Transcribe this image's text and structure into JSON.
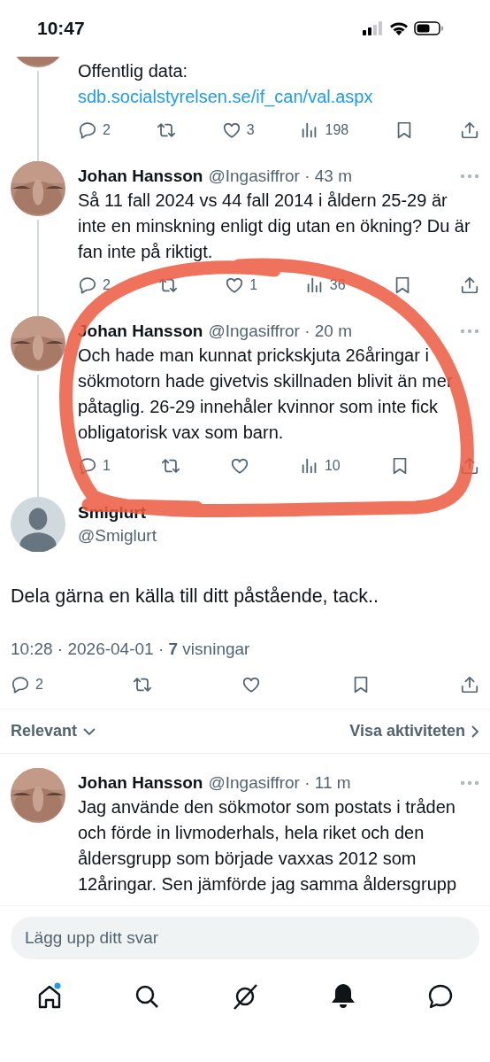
{
  "status_bar": {
    "time": "10:47"
  },
  "thread": [
    {
      "kind": "cut",
      "text": "Offentlig data: ",
      "link": "sdb.socialstyrelsen.se/if_can/val.aspx",
      "actions": [
        {
          "kind": "reply",
          "count": "2"
        },
        {
          "kind": "repost"
        },
        {
          "kind": "like",
          "count": "3"
        },
        {
          "kind": "views",
          "count": "198"
        },
        {
          "kind": "bookmark"
        },
        {
          "kind": "share"
        }
      ]
    },
    {
      "kind": "reply",
      "name": "Johan Hansson",
      "byline": "@Ingasiffror · 43 m",
      "text": "Så 11 fall 2024 vs 44 fall 2014 i åldern 25-29 är inte en minskning enligt dig utan en ökning? Du är fan inte på riktigt.",
      "actions": [
        {
          "kind": "reply",
          "count": "2"
        },
        {
          "kind": "repost"
        },
        {
          "kind": "like",
          "count": "1"
        },
        {
          "kind": "views",
          "count": "36"
        },
        {
          "kind": "bookmark"
        },
        {
          "kind": "share"
        }
      ]
    },
    {
      "kind": "reply",
      "name": "Johan Hansson",
      "byline": "@Ingasiffror · 20 m",
      "text": "Och hade man kunnat prickskjuta 26åringar i sökmotorn hade givetvis skillnaden blivit än mer påtaglig. 26-29 innehåler kvinnor som inte fick obligatorisk vax som barn.",
      "actions": [
        {
          "kind": "reply",
          "count": "1"
        },
        {
          "kind": "repost"
        },
        {
          "kind": "like"
        },
        {
          "kind": "views",
          "count": "10"
        },
        {
          "kind": "bookmark"
        },
        {
          "kind": "share"
        }
      ]
    }
  ],
  "main_post": {
    "avatar": {
      "kind": "default"
    },
    "name": "Smiglurt",
    "handle": "@Smiglurt",
    "text": "Dela gärna en källa till ditt påstående, tack..",
    "meta": "10:28 · 2026-04-01 · **7** visningar",
    "actions": [
      {
        "kind": "reply",
        "count": "2"
      },
      {
        "kind": "repost"
      },
      {
        "kind": "like"
      },
      {
        "kind": "bookmark"
      },
      {
        "kind": "share"
      }
    ]
  },
  "sort": {
    "label": "Relevant",
    "activity_link": "Visa aktiviteten"
  },
  "replies": [
    {
      "name": "Johan Hansson",
      "byline": "@Ingasiffror · 11 m",
      "text": "Jag använde den sökmotor som postats i tråden och förde in livmoderhals, hela riket och den åldersgrupp som började vaxxas 2012 som 12åringar. Sen jämförde jag samma åldersgrupp"
    }
  ],
  "reply_field": {
    "placeholder": "Lägg upp ditt svar"
  },
  "nav": [
    {
      "kind": "home",
      "badge": true,
      "filled": false
    },
    {
      "kind": "search",
      "badge": false,
      "filled": false
    },
    {
      "kind": "grok",
      "badge": false,
      "filled": false
    },
    {
      "kind": "bell",
      "badge": false,
      "filled": true
    },
    {
      "kind": "messages",
      "badge": false,
      "filled": false
    }
  ],
  "annotation": {
    "kind": "ring"
  }
}
